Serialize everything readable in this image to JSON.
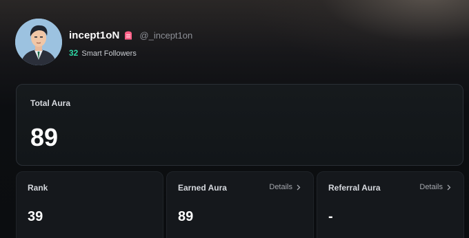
{
  "profile": {
    "display_name": "incept1oN",
    "handle": "@_incept1on",
    "followers_count": "32",
    "followers_label": "Smart Followers"
  },
  "total_aura": {
    "label": "Total Aura",
    "value": "89"
  },
  "stats": {
    "rank": {
      "label": "Rank",
      "value": "39"
    },
    "earned": {
      "label": "Earned Aura",
      "value": "89",
      "details": "Details"
    },
    "referral": {
      "label": "Referral Aura",
      "value": "-",
      "details": "Details"
    }
  },
  "colors": {
    "accent_green": "#2fd7a6",
    "badge_pink": "#ff5f86",
    "card_bg": "#13161a"
  },
  "icons": {
    "badge": "pink-badge-icon",
    "details_chevron": "chevron-right-icon"
  }
}
